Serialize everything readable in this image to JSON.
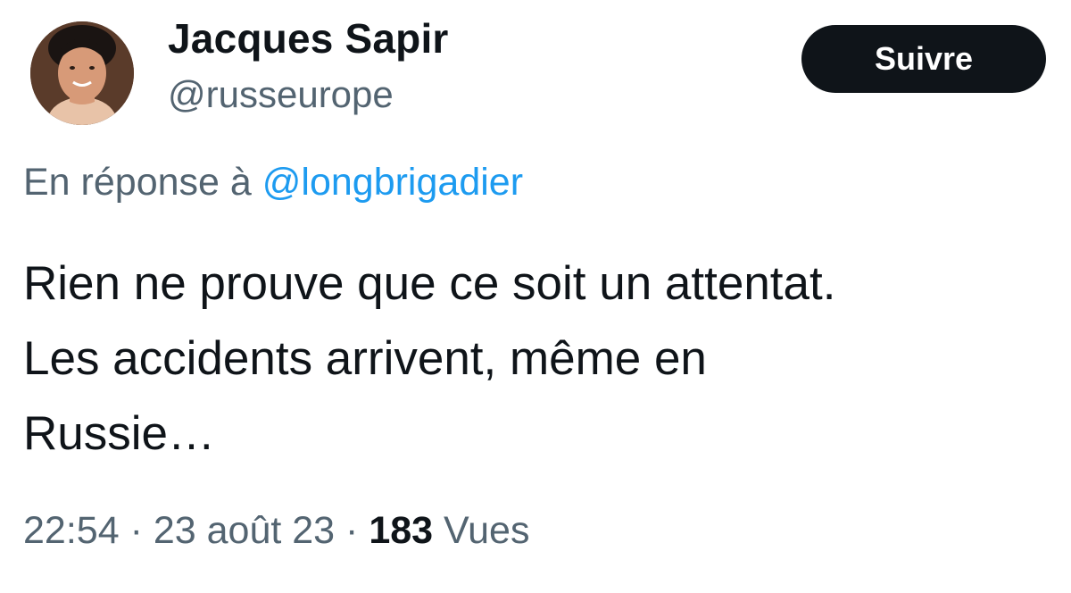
{
  "author": {
    "display_name": "Jacques Sapir",
    "handle": "@russeurope",
    "avatar_icon": "profile-photo"
  },
  "follow_button": {
    "label": "Suivre"
  },
  "reply": {
    "prefix": "En réponse à",
    "mention": "@longbrigadier"
  },
  "tweet": {
    "lines": [
      "Rien ne prouve que ce soit un attentat.",
      "Les accidents arrivent, même en",
      "Russie…"
    ]
  },
  "meta": {
    "time": "22:54",
    "separator": "·",
    "date": "23 août 23",
    "views_count": "183",
    "views_label": "Vues"
  },
  "colors": {
    "text_primary": "#0f1419",
    "text_secondary": "#536471",
    "link": "#1d9bf0",
    "button_bg": "#0f1419",
    "button_text": "#ffffff"
  }
}
